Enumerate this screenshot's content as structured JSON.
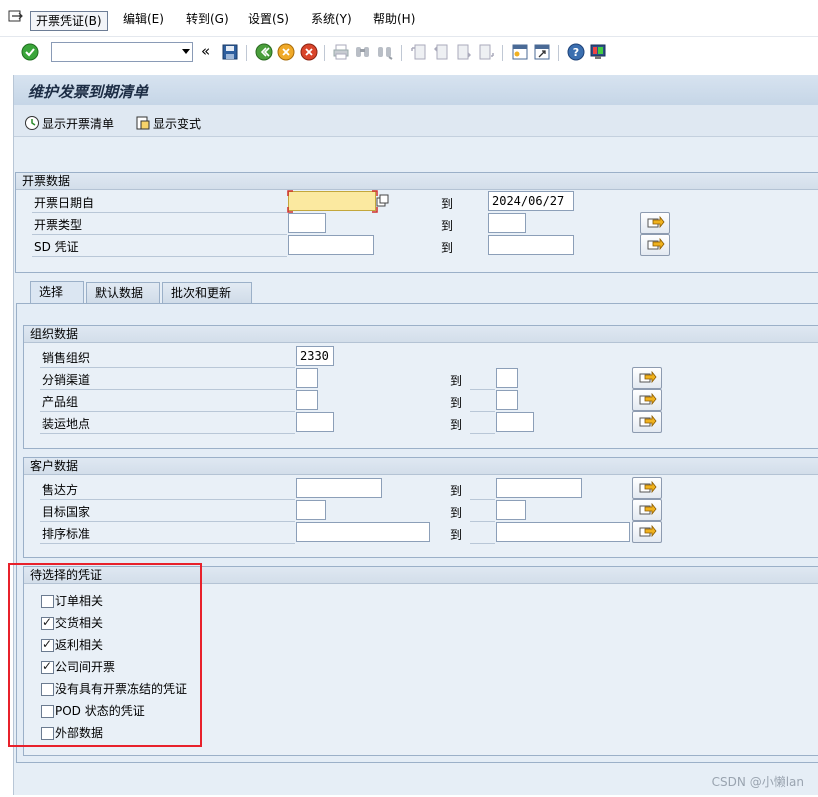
{
  "menu": {
    "items": [
      "开票凭证(B)",
      "编辑(E)",
      "转到(G)",
      "设置(S)",
      "系统(Y)",
      "帮助(H)"
    ]
  },
  "toolbar": {
    "command_value": "",
    "icons": [
      "enter-check-icon",
      "back-double-arrow-icon",
      "save-icon",
      "back-icon",
      "exit-icon",
      "cancel-icon",
      "print-icon",
      "find-icon",
      "find-next-icon",
      "first-page-icon",
      "prev-page-icon",
      "next-page-icon",
      "last-page-icon",
      "new-session-icon",
      "shortcut-icon",
      "help-icon",
      "customize-layout-icon"
    ]
  },
  "title": "维护发票到期清单",
  "app_toolbar": {
    "show_list": "显示开票清单",
    "show_variant": "显示变式"
  },
  "billing_data": {
    "title": "开票数据",
    "to_label": "到",
    "rows": [
      {
        "label": "开票日期自",
        "from": "",
        "to": "2024/06/27"
      },
      {
        "label": "开票类型",
        "from": "",
        "to": ""
      },
      {
        "label": "SD 凭证",
        "from": "",
        "to": ""
      }
    ]
  },
  "tabs": [
    "选择",
    "默认数据",
    "批次和更新"
  ],
  "org_data": {
    "title": "组织数据",
    "to_label": "到",
    "rows": [
      {
        "label": "销售组织",
        "from": "2330",
        "to": ""
      },
      {
        "label": "分销渠道",
        "from": "",
        "to": ""
      },
      {
        "label": "产品组",
        "from": "",
        "to": ""
      },
      {
        "label": "装运地点",
        "from": "",
        "to": ""
      }
    ]
  },
  "customer_data": {
    "title": "客户数据",
    "to_label": "到",
    "rows": [
      {
        "label": "售达方",
        "from": "",
        "to": ""
      },
      {
        "label": "目标国家",
        "from": "",
        "to": ""
      },
      {
        "label": "排序标准",
        "from": "",
        "to": ""
      }
    ]
  },
  "docs": {
    "title": "待选择的凭证",
    "items": [
      {
        "label": "订单相关",
        "checked": false
      },
      {
        "label": "交货相关",
        "checked": true
      },
      {
        "label": "返利相关",
        "checked": true
      },
      {
        "label": "公司间开票",
        "checked": true
      },
      {
        "label": "没有具有开票冻结的凭证",
        "checked": false
      },
      {
        "label": "POD 状态的凭证",
        "checked": false
      },
      {
        "label": "外部数据",
        "checked": false
      }
    ]
  },
  "watermark": "CSDN @小懒lan",
  "colors": {
    "highlight": "#e8212b",
    "required_field": "#fbe9a0"
  }
}
